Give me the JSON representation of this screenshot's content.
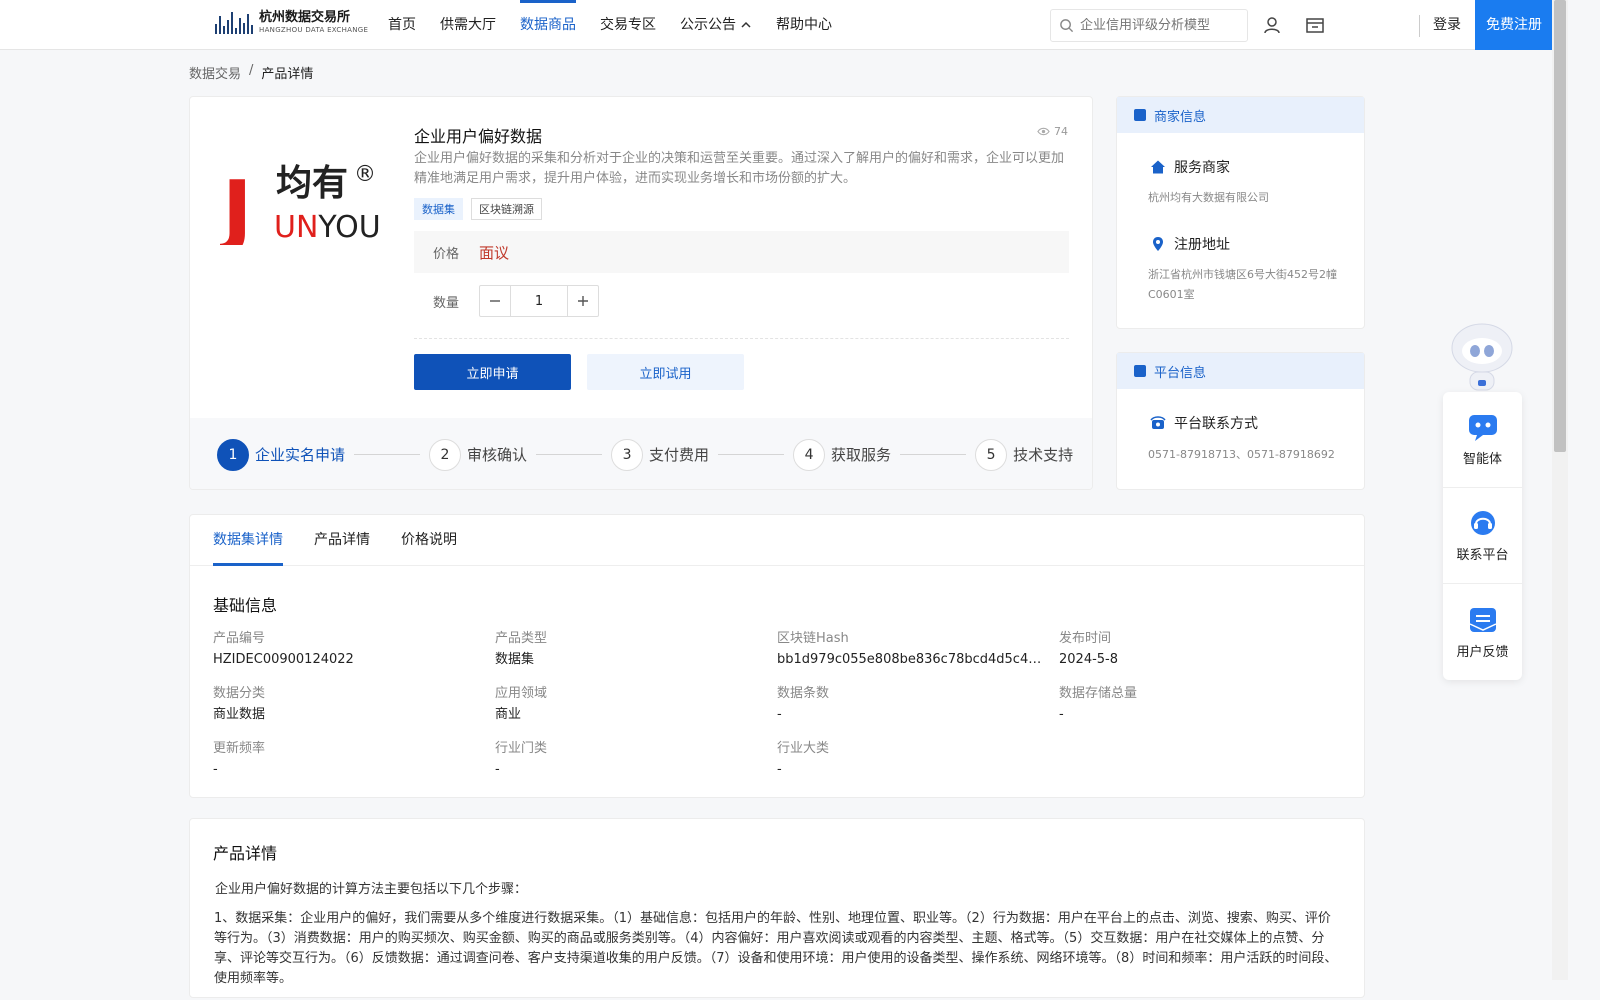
{
  "header": {
    "logo_cn": "杭州数据交易所",
    "logo_en": "HANGZHOU DATA EXCHANGE",
    "nav": [
      {
        "label": "首页"
      },
      {
        "label": "供需大厅"
      },
      {
        "label": "数据商品"
      },
      {
        "label": "交易专区"
      },
      {
        "label": "公示公告"
      },
      {
        "label": "帮助中心"
      }
    ],
    "active_nav_index": 2,
    "search_placeholder": "企业信用评级分析模型",
    "login_label": "登录",
    "register_label": "免费注册"
  },
  "breadcrumb": {
    "parent": "数据交易",
    "separator": "/",
    "current": "产品详情"
  },
  "product": {
    "logo_text_cn": "均有",
    "logo_mark": "J",
    "logo_text_en": "UNYOU",
    "logo_registered": "®",
    "title": "企业用户偏好数据",
    "views": "74",
    "description": "企业用户偏好数据的采集和分析对于企业的决策和运营至关重要。通过深入了解用户的偏好和需求，企业可以更加精准地满足用户需求，提升用户体验，进而实现业务增长和市场份额的扩大。",
    "tags": [
      "数据集",
      "区块链溯源"
    ],
    "price_label": "价格",
    "price_value": "面议",
    "quantity_label": "数量",
    "quantity_value": "1",
    "apply_label": "立即申请",
    "trial_label": "立即试用",
    "steps": [
      {
        "num": "1",
        "label": "企业实名申请"
      },
      {
        "num": "2",
        "label": "审核确认"
      },
      {
        "num": "3",
        "label": "支付费用"
      },
      {
        "num": "4",
        "label": "获取服务"
      },
      {
        "num": "5",
        "label": "技术支持"
      }
    ]
  },
  "merchant": {
    "heading": "商家信息",
    "service_title": "服务商家",
    "service_value": "杭州均有大数据有限公司",
    "address_title": "注册地址",
    "address_value": "浙江省杭州市钱塘区6号大街452号2幢C0601室"
  },
  "platform": {
    "heading": "平台信息",
    "contact_title": "平台联系方式",
    "contact_value": "0571-87918713、0571-87918692"
  },
  "tabs": [
    {
      "label": "数据集详情"
    },
    {
      "label": "产品详情"
    },
    {
      "label": "价格说明"
    }
  ],
  "basic_info": {
    "title": "基础信息",
    "fields": [
      {
        "key": "产品编号",
        "value": "HZIDEC00900124022"
      },
      {
        "key": "产品类型",
        "value": "数据集"
      },
      {
        "key": "区块链Hash",
        "value": "bb1d979c055e808be836c78bcd4d5c4fe3..."
      },
      {
        "key": "发布时间",
        "value": "2024-5-8"
      },
      {
        "key": "数据分类",
        "value": "商业数据"
      },
      {
        "key": "应用领域",
        "value": "商业"
      },
      {
        "key": "数据条数",
        "value": "-"
      },
      {
        "key": "数据存储总量",
        "value": "-"
      },
      {
        "key": "更新频率",
        "value": "-"
      },
      {
        "key": "行业门类",
        "value": "-"
      },
      {
        "key": "行业大类",
        "value": "-"
      }
    ]
  },
  "product_detail": {
    "title": "产品详情",
    "intro": "企业用户偏好数据的计算方法主要包括以下几个步骤：",
    "body": "1、数据采集：企业用户的偏好，我们需要从多个维度进行数据采集。（1）基础信息：包括用户的年龄、性别、地理位置、职业等。（2）行为数据：用户在平台上的点击、浏览、搜索、购买、评价等行为。（3）消费数据：用户的购买频次、购买金额、购买的商品或服务类别等。（4）内容偏好：用户喜欢阅读或观看的内容类型、主题、格式等。（5）交互数据：用户在社交媒体上的点赞、分享、评论等交互行为。（6）反馈数据：通过调查问卷、客户支持渠道收集的用户反馈。（7）设备和使用环境：用户使用的设备类型、操作系统、网络环境等。（8）时间和频率：用户活跃的时间段、使用频率等。"
  },
  "float_panel": {
    "items": [
      {
        "label": "智能体",
        "icon": "chatbot-icon"
      },
      {
        "label": "联系平台",
        "icon": "headset-icon"
      },
      {
        "label": "用户反馈",
        "icon": "mail-icon"
      }
    ]
  },
  "colors": {
    "primary": "#1a62c9",
    "primary_dark": "#0f52b8",
    "register_bg": "#1a7cf0",
    "price_red": "#c0392b",
    "logo_red": "#e0201c",
    "logo_navy": "#1d3f72"
  }
}
